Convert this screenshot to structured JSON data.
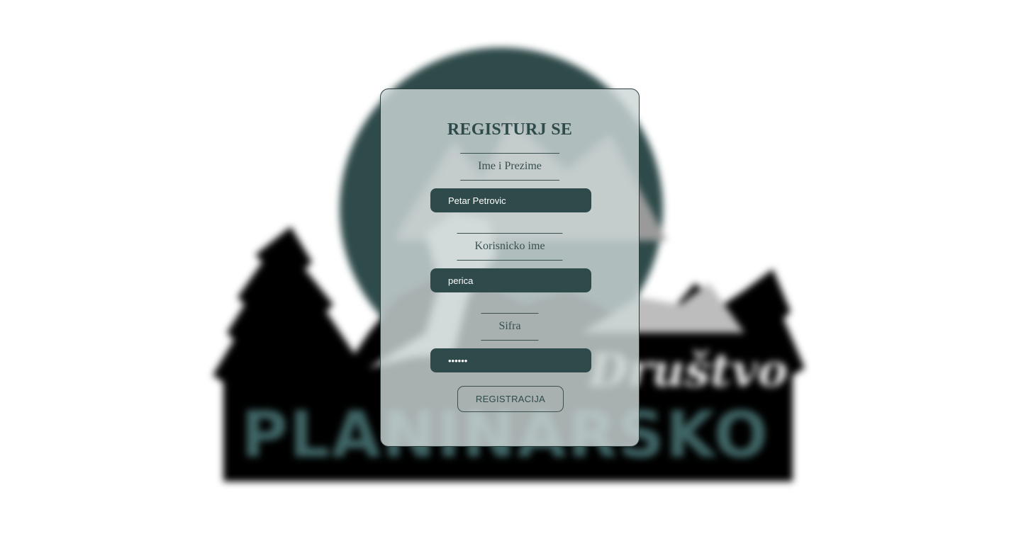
{
  "background": {
    "logo_text_main": "PLANINARSKO",
    "logo_text_script": "Društvo",
    "colors": {
      "dark": "#000000",
      "teal": "#2f4a4a",
      "text_teal": "#3f6464"
    }
  },
  "form": {
    "title": "REGISTURJ SE",
    "fields": [
      {
        "label": "Ime i Prezime",
        "value": "Petar Petrovic",
        "type": "text"
      },
      {
        "label": "Korisnicko ime",
        "value": "perica",
        "type": "text"
      },
      {
        "label": "Sifra",
        "value": "••••••",
        "type": "password"
      }
    ],
    "submit_label": "REGISTRACIJA"
  }
}
